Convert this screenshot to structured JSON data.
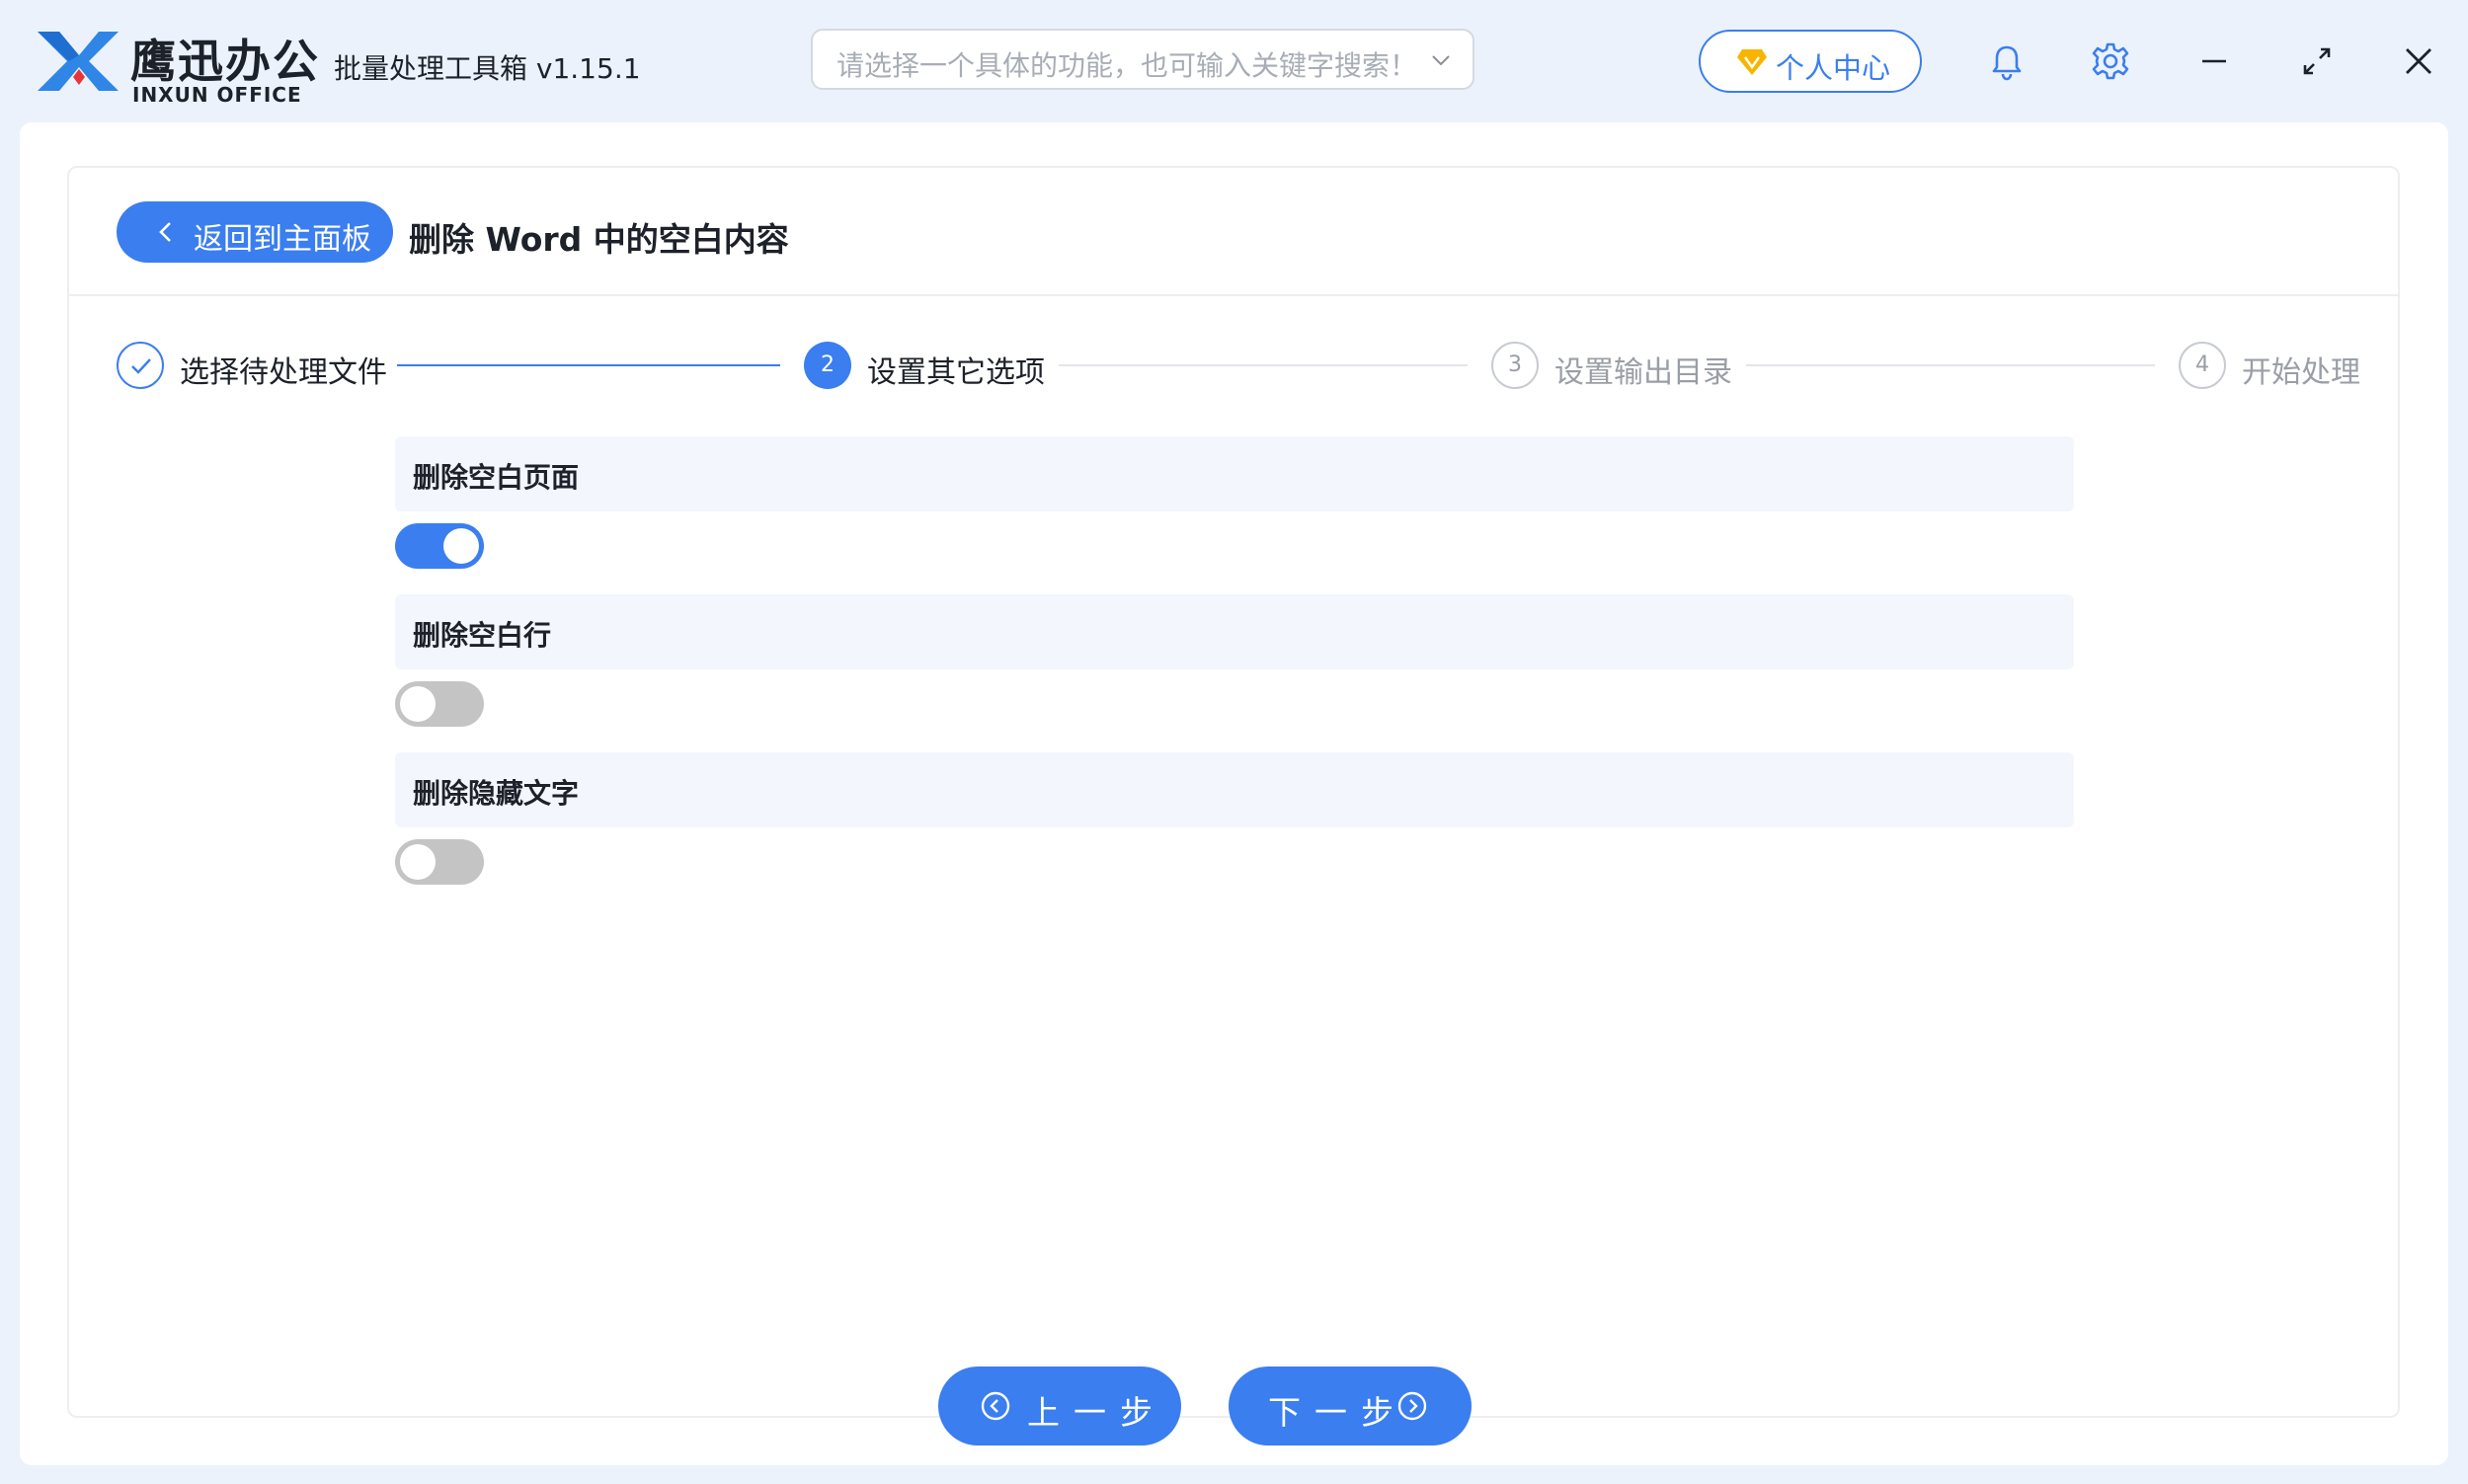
{
  "titlebar": {
    "brand_cn": "鹰迅办公",
    "brand_en": "INXUN OFFICE",
    "app_title": "批量处理工具箱 v1.15.1",
    "search_placeholder": "请选择一个具体的功能，也可输入关键字搜索！",
    "user_center_label": "个人中心",
    "icons": [
      "bell-icon",
      "gear-icon",
      "minimize-icon",
      "maximize-icon",
      "close-icon"
    ]
  },
  "header": {
    "back_label": "返回到主面板",
    "title": "删除 Word 中的空白内容"
  },
  "steps": [
    {
      "label": "选择待处理文件",
      "number": "",
      "state": "done"
    },
    {
      "label": "设置其它选项",
      "number": "2",
      "state": "active"
    },
    {
      "label": "设置输出目录",
      "number": "3",
      "state": "pending"
    },
    {
      "label": "开始处理",
      "number": "4",
      "state": "pending"
    }
  ],
  "options": [
    {
      "label": "删除空白页面",
      "enabled": true
    },
    {
      "label": "删除空白行",
      "enabled": false
    },
    {
      "label": "删除隐藏文字",
      "enabled": false
    }
  ],
  "footer": {
    "prev_label": "上一步",
    "next_label": "下一步"
  },
  "colors": {
    "accent": "#3a7ef0",
    "toggle_off": "#c4c4c4",
    "option_bg": "#f3f6fd",
    "pending": "#9a9ea6",
    "gold": "#f7b500"
  }
}
